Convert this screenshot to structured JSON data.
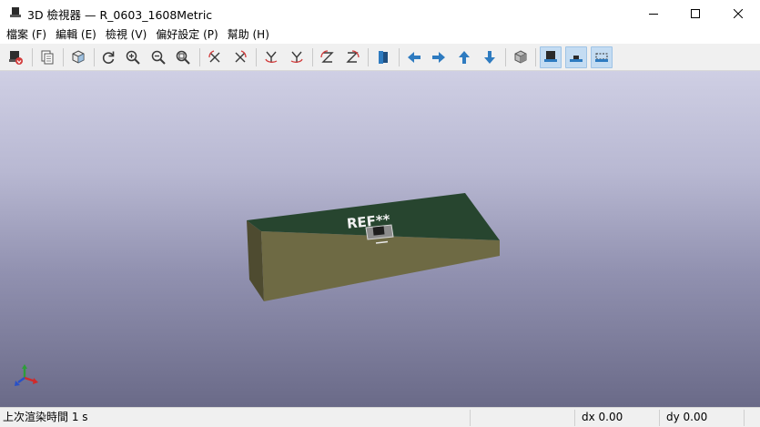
{
  "window": {
    "title": "3D 檢視器 — R_0603_1608Metric",
    "app_icon": "monitor-icon",
    "controls": [
      "minimize-icon",
      "maximize-icon",
      "close-icon"
    ]
  },
  "menu": {
    "items": [
      {
        "label": "檔案 (F)"
      },
      {
        "label": "編輯 (E)"
      },
      {
        "label": "檢視 (V)"
      },
      {
        "label": "偏好設定 (P)"
      },
      {
        "label": "幫助 (H)"
      }
    ]
  },
  "toolbar": {
    "buttons": [
      {
        "icon": "render-export-icon",
        "active": false
      },
      {
        "icon": "copy-image-icon",
        "active": false
      },
      {
        "icon": "raytrace-cube-icon",
        "active": false
      },
      {
        "icon": "reload-icon",
        "active": false
      },
      {
        "icon": "zoom-in-icon",
        "active": false
      },
      {
        "icon": "zoom-out-icon",
        "active": false
      },
      {
        "icon": "zoom-fit-icon",
        "active": false
      },
      {
        "icon": "rotate-x-ccw-icon",
        "active": false
      },
      {
        "icon": "rotate-x-cw-icon",
        "active": false
      },
      {
        "icon": "rotate-y-ccw-icon",
        "active": false
      },
      {
        "icon": "rotate-y-cw-icon",
        "active": false
      },
      {
        "icon": "rotate-z-ccw-icon",
        "active": false
      },
      {
        "icon": "rotate-z-cw-icon",
        "active": false
      },
      {
        "icon": "flip-board-icon",
        "active": false
      },
      {
        "icon": "pan-left-icon",
        "active": false
      },
      {
        "icon": "pan-right-icon",
        "active": false
      },
      {
        "icon": "pan-up-icon",
        "active": false
      },
      {
        "icon": "pan-down-icon",
        "active": false
      },
      {
        "icon": "orthographic-cube-icon",
        "active": false
      },
      {
        "icon": "show-tht-icon",
        "active": true
      },
      {
        "icon": "show-smd-icon",
        "active": true
      },
      {
        "icon": "show-virtual-icon",
        "active": true
      }
    ],
    "colors": {
      "icon_blue": "#2e7bc0",
      "icon_dark": "#3c3c3c",
      "icon_red": "#d23c3c"
    }
  },
  "viewport": {
    "silkscreen_text": "REF**",
    "board_top_color": "#27452f",
    "board_side_color": "#6e6a44",
    "axes_icon": "xyz-axes-icon"
  },
  "status": {
    "render_time": "上次渲染時間 1 s",
    "dx": "dx 0.00",
    "dy": "dy 0.00"
  }
}
